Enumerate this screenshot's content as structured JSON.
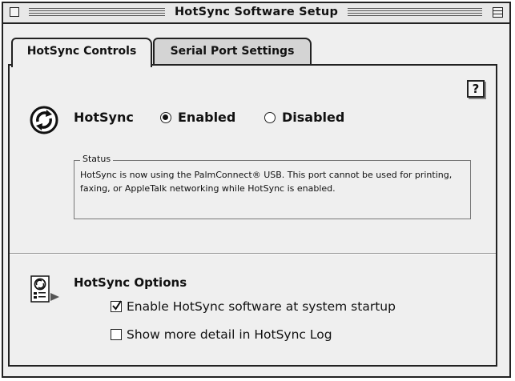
{
  "window": {
    "title": "HotSync Software Setup"
  },
  "tabs": [
    {
      "label": "HotSync Controls",
      "active": true
    },
    {
      "label": "Serial Port Settings",
      "active": false
    }
  ],
  "help_button": {
    "label": "?"
  },
  "hotsync": {
    "label": "HotSync",
    "enabled_label": "Enabled",
    "disabled_label": "Disabled",
    "selected": "Enabled"
  },
  "status": {
    "legend": "Status",
    "text": "HotSync is now using the PalmConnect® USB.  This port cannot be used for printing, faxing, or AppleTalk networking while HotSync is enabled."
  },
  "options": {
    "title": "HotSync Options",
    "checkboxes": [
      {
        "label": "Enable HotSync software at system startup",
        "checked": true
      },
      {
        "label": "Show more detail in HotSync Log",
        "checked": false
      }
    ]
  },
  "icons": [
    "hotsync-icon",
    "hotsync-options-icon",
    "help-icon",
    "close-box-icon",
    "zoom-box-icon"
  ]
}
